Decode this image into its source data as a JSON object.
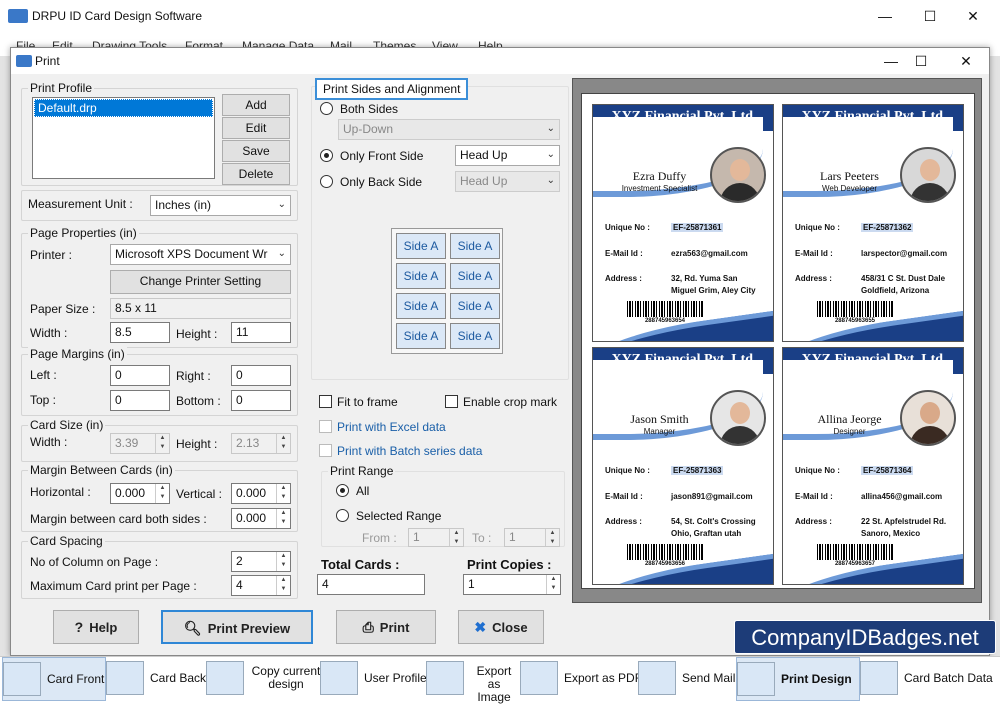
{
  "app": {
    "title": "DRPU ID Card Design Software",
    "menu": [
      "File",
      "Edit",
      "Drawing Tools",
      "Format",
      "Manage Data",
      "Mail",
      "Themes",
      "View",
      "Help"
    ]
  },
  "dialog": {
    "title": "Print",
    "print_profile": {
      "label": "Print Profile",
      "items": [
        "Default.drp"
      ],
      "buttons": {
        "add": "Add",
        "edit": "Edit",
        "save": "Save",
        "delete": "Delete"
      }
    },
    "measurement": {
      "label": "Measurement Unit :",
      "value": "Inches (in)"
    },
    "page_properties": {
      "label": "Page Properties (in)",
      "printer_label": "Printer :",
      "printer_value": "Microsoft XPS Document Wr",
      "change_printer": "Change Printer Setting",
      "paper_size_label": "Paper Size :",
      "paper_size_value": "8.5 x 11",
      "width_label": "Width :",
      "width_value": "8.5",
      "height_label": "Height :",
      "height_value": "11"
    },
    "page_margins": {
      "label": "Page Margins (in)",
      "left_label": "Left :",
      "left_value": "0",
      "right_label": "Right :",
      "right_value": "0",
      "top_label": "Top :",
      "top_value": "0",
      "bottom_label": "Bottom :",
      "bottom_value": "0"
    },
    "card_size": {
      "label": "Card Size (in)",
      "width_label": "Width :",
      "width_value": "3.39",
      "height_label": "Height :",
      "height_value": "2.13"
    },
    "margin_between": {
      "label": "Margin Between Cards (in)",
      "horizontal_label": "Horizontal :",
      "horizontal_value": "0.000",
      "vertical_label": "Vertical :",
      "vertical_value": "0.000",
      "both_label": "Margin between card both sides :",
      "both_value": "0.000"
    },
    "card_spacing": {
      "label": "Card Spacing",
      "columns_label": "No of Column on Page :",
      "columns_value": "2",
      "max_label": "Maximum Card print per Page :",
      "max_value": "4"
    },
    "print_sides": {
      "label": "Print Sides and Alignment",
      "both_sides": "Both Sides",
      "both_select": "Up-Down",
      "front_only": "Only Front Side",
      "front_select": "Head Up",
      "back_only": "Only Back Side",
      "back_select": "Head Up",
      "grid": [
        "Side A",
        "Side A",
        "Side A",
        "Side A",
        "Side A",
        "Side A",
        "Side A",
        "Side A"
      ]
    },
    "options": {
      "fit_to_frame": "Fit to frame",
      "crop_mark": "Enable crop mark",
      "excel": "Print with Excel data",
      "batch": "Print with Batch series data"
    },
    "print_range": {
      "label": "Print Range",
      "all": "All",
      "selected": "Selected Range",
      "from_label": "From :",
      "from_value": "1",
      "to_label": "To :",
      "to_value": "1"
    },
    "totals": {
      "total_label": "Total Cards :",
      "total_value": "4",
      "copies_label": "Print Copies :",
      "copies_value": "1"
    },
    "buttons": {
      "help": "Help",
      "preview": "Print Preview",
      "print": "Print",
      "close": "Close"
    }
  },
  "cards": [
    {
      "company": "XYZ Financial Pvt. Ltd.",
      "name": "Ezra Duffy",
      "title": "Investment Specialist",
      "id_label": "Unique No :",
      "id": "EF-25871361",
      "email_label": "E-Mail Id :",
      "email": "ezra563@gmail.com",
      "addr_label": "Address :",
      "addr1": "32, Rd. Yuma San",
      "addr2": "Miguel Grim, Aley City",
      "barcode": "288745963654"
    },
    {
      "company": "XYZ Financial Pvt. Ltd.",
      "name": "Lars Peeters",
      "title": "Web Developer",
      "id_label": "Unique No :",
      "id": "EF-25871362",
      "email_label": "E-Mail Id :",
      "email": "larspector@gmail.com",
      "addr_label": "Address :",
      "addr1": "458/31 C  St. Dust Dale",
      "addr2": "Goldfield, Arizona",
      "barcode": "288745963655"
    },
    {
      "company": "XYZ Financial Pvt. Ltd.",
      "name": "Jason Smith",
      "title": "Manager",
      "id_label": "Unique No :",
      "id": "EF-25871363",
      "email_label": "E-Mail Id :",
      "email": "jason891@gmail.com",
      "addr_label": "Address :",
      "addr1": "54, St. Colt's Crossing",
      "addr2": "Ohio, Graftan utah",
      "barcode": "288745963656"
    },
    {
      "company": "XYZ Financial Pvt. Ltd.",
      "name": "Allina Jeorge",
      "title": "Designer",
      "id_label": "Unique No :",
      "id": "EF-25871364",
      "email_label": "E-Mail Id :",
      "email": "allina456@gmail.com",
      "addr_label": "Address :",
      "addr1": "22 St. Apfelstrudel Rd.",
      "addr2": "Sanoro, Mexico",
      "barcode": "288745963657"
    }
  ],
  "taskbar": [
    {
      "label": "Card Front",
      "icon": "card-front-icon"
    },
    {
      "label": "Card Back",
      "icon": "card-back-icon"
    },
    {
      "label": "Copy current design",
      "icon": "copy-design-icon"
    },
    {
      "label": "User Profile",
      "icon": "user-profile-icon"
    },
    {
      "label": "Export as Image",
      "icon": "export-image-icon"
    },
    {
      "label": "Export as PDF",
      "icon": "export-pdf-icon"
    },
    {
      "label": "Send Mail",
      "icon": "send-mail-icon"
    },
    {
      "label": "Print Design",
      "icon": "printer-icon"
    },
    {
      "label": "Card Batch Data",
      "icon": "batch-data-icon"
    }
  ],
  "watermark": "CompanyIDBadges.net",
  "colors": {
    "card_navy": "#1a3f86",
    "card_accent": "#6d9ad8",
    "highlight": "#cbdaf0"
  }
}
